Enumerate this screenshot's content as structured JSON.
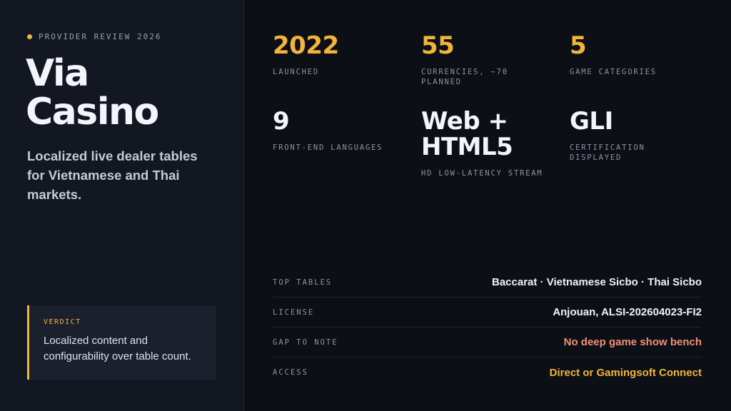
{
  "kicker": "PROVIDER REVIEW 2026",
  "title_line1": "Via",
  "title_line2": "Casino",
  "subtitle": "Localized live dealer tables for Vietnamese and Thai markets.",
  "verdict": {
    "label": "VERDICT",
    "text": "Localized content and configurability over table count."
  },
  "stats": [
    {
      "value": "2022",
      "label": "LAUNCHED",
      "accent": true
    },
    {
      "value": "55",
      "label": "CURRENCIES, ~70 PLANNED",
      "accent": true
    },
    {
      "value": "5",
      "label": "GAME CATEGORIES",
      "accent": true
    },
    {
      "value": "9",
      "label": "FRONT-END LANGUAGES",
      "accent": false
    },
    {
      "value": "Web + HTML5",
      "label": "HD LOW-LATENCY STREAM",
      "accent": false
    },
    {
      "value": "GLI",
      "label": "CERTIFICATION DISPLAYED",
      "accent": false
    }
  ],
  "details": [
    {
      "label": "TOP TABLES",
      "value": "Baccarat · Vietnamese Sicbo · Thai Sicbo",
      "tone": "normal"
    },
    {
      "label": "LICENSE",
      "value": "Anjouan, ALSI-202604023-FI2",
      "tone": "normal"
    },
    {
      "label": "GAP TO NOTE",
      "value": "No deep game show bench",
      "tone": "warn"
    },
    {
      "label": "ACCESS",
      "value": "Direct or Gamingsoft Connect",
      "tone": "gold"
    }
  ],
  "colors": {
    "accent": "#f2b43c",
    "warn": "#f28f78",
    "panel": "#121722",
    "background": "#0c0f15"
  }
}
